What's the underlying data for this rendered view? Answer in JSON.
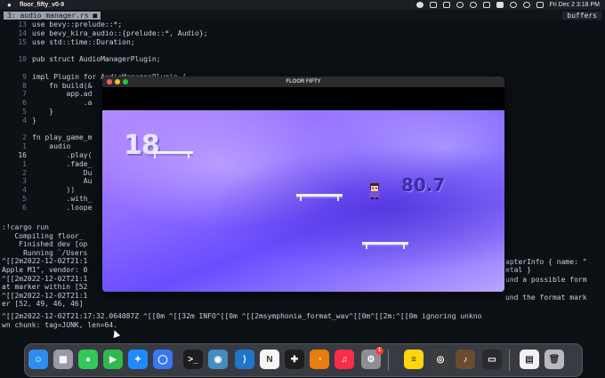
{
  "menubar": {
    "app_title": "floor_fifty_v0-9",
    "datetime": "Fri Dec 2  3:18 PM"
  },
  "tmux": {
    "active_tab": "3: audio_manager.rs",
    "modified_marker": "■",
    "buffers_label": "buffers"
  },
  "editor": {
    "lines": [
      {
        "num": "13",
        "text": "use bevy::prelude::*;"
      },
      {
        "num": "14",
        "text": "use bevy_kira_audio::{prelude::*, Audio};"
      },
      {
        "num": "15",
        "text": "use std::time::Duration;"
      },
      {
        "num": "",
        "text": ""
      },
      {
        "num": "10",
        "text": "pub struct AudioManagerPlugin;"
      },
      {
        "num": "",
        "text": ""
      },
      {
        "num": "9",
        "text": "impl Plugin for AudioManagerPlugin {"
      },
      {
        "num": "8",
        "text": "    fn build(&"
      },
      {
        "num": "7",
        "text": "        app.ad"
      },
      {
        "num": "6",
        "text": "            .a"
      },
      {
        "num": "5",
        "text": "    }"
      },
      {
        "num": "4",
        "text": "}"
      },
      {
        "num": "",
        "text": ""
      },
      {
        "num": "2",
        "text": "fn play_game_m"
      },
      {
        "num": "1",
        "text": "    audio"
      },
      {
        "num": "16",
        "text": "        .play("
      },
      {
        "num": "1",
        "text": "        .fade_"
      },
      {
        "num": "2",
        "text": "            Du"
      },
      {
        "num": "3",
        "text": "            Au"
      },
      {
        "num": "4",
        "text": "        ))"
      },
      {
        "num": "5",
        "text": "        .with_"
      },
      {
        "num": "6",
        "text": "        .loope"
      }
    ]
  },
  "console": {
    "left_lines": [
      ":!cargo run",
      "   Compiling floor_",
      "    Finished dev [op",
      "     Running `/Users",
      "^[[2m2022-12-02T21:1",
      "Apple M1\", vendor: 0",
      "^[[2m2022-12-02T21:1",
      "at marker within [52",
      "^[[2m2022-12-02T21:1",
      "er [52, 49, 46, 46]"
    ],
    "right_lines": [
      "apterInfo { name: \"",
      "etal }",
      "und a possible form",
      "",
      "und the format mark",
      ""
    ],
    "full_line_1": "^[[2m2022-12-02T21:17:32.064087Z ^[[0m ^[[32m INFO^[[0m ^[[2msymphonia_format_wav^[[0m^[[2m:^[[0m ignoring unkno",
    "full_line_2": "wn chunk: tag=JUNK, len=64."
  },
  "game": {
    "window_title": "FLOOR FIFTY",
    "floor_number": "18",
    "timer": "80.7"
  },
  "dock": {
    "apps": [
      {
        "name": "finder-icon",
        "glyph": "☺",
        "color": "#2f8cf0"
      },
      {
        "name": "launchpad-icon",
        "glyph": "▦",
        "color": "#9a9aa6"
      },
      {
        "name": "messages-icon",
        "glyph": "●",
        "color": "#34c759"
      },
      {
        "name": "facetime-icon",
        "glyph": "▶",
        "color": "#30b94c"
      },
      {
        "name": "safari-icon",
        "glyph": "✦",
        "color": "#1f8bff"
      },
      {
        "name": "signal-icon",
        "glyph": "◯",
        "color": "#3a76f0"
      },
      {
        "name": "terminal-icon",
        "glyph": ">_",
        "color": "#1d1d1f"
      },
      {
        "name": "godot-icon",
        "glyph": "◉",
        "color": "#478cbf"
      },
      {
        "name": "vscode-icon",
        "glyph": "⟩",
        "color": "#1f76c8"
      },
      {
        "name": "notion-icon",
        "glyph": "N",
        "color": "#f5f5f5"
      },
      {
        "name": "figma-icon",
        "glyph": "✚",
        "color": "#1e1e1e"
      },
      {
        "name": "blender-icon",
        "glyph": "◔",
        "color": "#e87d0d"
      },
      {
        "name": "music-icon",
        "glyph": "♫",
        "color": "#fa2d48"
      },
      {
        "name": "system-settings-icon",
        "glyph": "⚙",
        "color": "#8e8e93"
      },
      {
        "name": "notes-icon",
        "glyph": "≡",
        "color": "#ffd60a"
      },
      {
        "name": "quicktime-icon",
        "glyph": "◎",
        "color": "#3d3d40"
      },
      {
        "name": "instruments-icon",
        "glyph": "♪",
        "color": "#6b4c2e"
      },
      {
        "name": "terminal-window-icon",
        "glyph": "▭",
        "color": "#2a2a2c"
      },
      {
        "name": "document-icon",
        "glyph": "▤",
        "color": "#f2f2f7"
      },
      {
        "name": "trash-icon",
        "glyph": "🗑",
        "color": "#b8b8c0"
      }
    ],
    "settings_badge": "1"
  }
}
